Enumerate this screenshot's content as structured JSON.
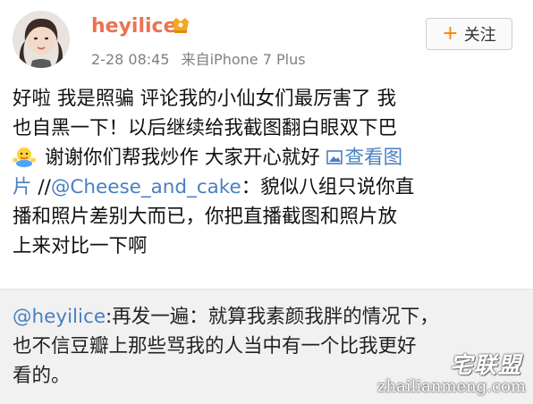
{
  "post": {
    "username": "heyilice",
    "time": "2-28 08:45",
    "source": "来自iPhone 7 Plus",
    "follow_label": "关注",
    "follow_plus": "+",
    "lines": [
      "好啦 我是照骗 评论我的小仙女们最厉害了 我",
      "也自黑一下！以后继续给我截图翻白眼双下巴",
      {
        "before": "谢谢你们帮我炒作  大家开心就好 ",
        "link": "查看图"
      },
      {
        "link_start": "片",
        "plain": " //",
        "mention": "@Cheese_and_cake",
        "after": "：貌似八组只说你直"
      },
      "播和照片差别大而已，你把直播截图和照片放",
      "上来对比一下啊"
    ],
    "emoji_icon": "hug-emoji-icon",
    "pic_icon": "picture-icon"
  },
  "repost": {
    "mention": "@heyilice",
    "line1_rest": ":再发一遍：就算我素颜我胖的情况下，",
    "line2": "也不信豆瓣上那些骂我的人当中有一个比我更好",
    "line3": "看的。"
  },
  "watermark": {
    "logo": "宅联盟",
    "url": "zhailianmeng.com"
  },
  "colors": {
    "username": "#eb7350",
    "link": "#4a7fc1",
    "repost_bg": "#f1f1f1",
    "follow_plus": "#ff8200"
  }
}
